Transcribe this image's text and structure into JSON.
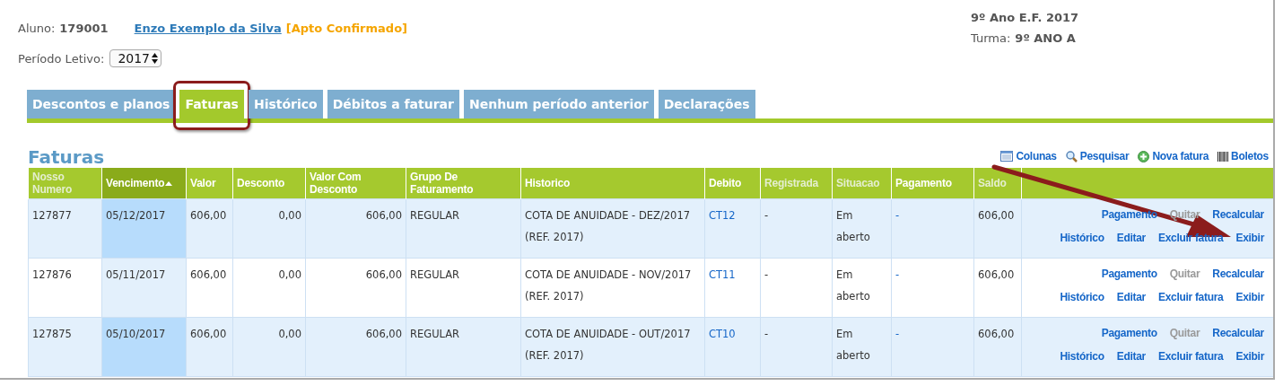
{
  "student": {
    "label": "Aluno:",
    "id": "179001",
    "name": "Enzo Exemplo da Silva",
    "status": "[Apto Confirmado]"
  },
  "class_info": {
    "grade": "9º Ano E.F. 2017",
    "turma_label": "Turma:",
    "turma": "9º ANO A"
  },
  "period": {
    "label": "Período Letivo:",
    "value": "2017"
  },
  "tabs": [
    {
      "label": "Descontos e planos",
      "selected": false,
      "highlighted": false
    },
    {
      "label": "Faturas",
      "selected": true,
      "highlighted": true
    },
    {
      "label": "Histórico",
      "selected": false,
      "highlighted": false
    },
    {
      "label": "Débitos a faturar",
      "selected": false,
      "highlighted": false
    },
    {
      "label": "Nenhum período anterior",
      "selected": false,
      "highlighted": false
    },
    {
      "label": "Declarações",
      "selected": false,
      "highlighted": false
    }
  ],
  "section_title": "Faturas",
  "toolbar": [
    {
      "kind": "columns",
      "label": "Colunas"
    },
    {
      "kind": "search",
      "label": "Pesquisar"
    },
    {
      "kind": "add",
      "label": "Nova fatura"
    },
    {
      "kind": "barcode",
      "label": "Boletos"
    }
  ],
  "table": {
    "columns": [
      {
        "label": "Nosso Numero",
        "dimmed": true,
        "sorted": false,
        "link": false
      },
      {
        "label": "Vencimento",
        "dimmed": false,
        "sorted": true,
        "link": false
      },
      {
        "label": "Valor",
        "dimmed": false,
        "sorted": false,
        "link": false
      },
      {
        "label": "Desconto",
        "dimmed": false,
        "sorted": false,
        "link": false
      },
      {
        "label": "Valor Com Desconto",
        "dimmed": false,
        "sorted": false,
        "link": false
      },
      {
        "label": "Grupo De Faturamento",
        "dimmed": false,
        "sorted": false,
        "link": false
      },
      {
        "label": "Historico",
        "dimmed": false,
        "sorted": false,
        "link": false
      },
      {
        "label": "Debito",
        "dimmed": false,
        "sorted": false,
        "link": true
      },
      {
        "label": "Registrada",
        "dimmed": true,
        "sorted": false,
        "link": false
      },
      {
        "label": "Situacao",
        "dimmed": true,
        "sorted": false,
        "link": false
      },
      {
        "label": "Pagamento",
        "dimmed": false,
        "sorted": false,
        "link": true
      },
      {
        "label": "Saldo",
        "dimmed": true,
        "sorted": false,
        "link": false
      }
    ],
    "rows": [
      {
        "cells": [
          "127877",
          "05/12/2017",
          "606,00",
          "0,00",
          "606,00",
          "REGULAR",
          "COTA DE ANUIDADE - DEZ/2017 (REF. 2017)",
          "CT12",
          "-",
          "Em aberto",
          "-",
          "606,00"
        ],
        "actions": [
          [
            {
              "label": "Pagamento",
              "disabled": false
            },
            {
              "label": "Quitar",
              "disabled": true
            },
            {
              "label": "Recalcular",
              "disabled": false
            }
          ],
          [
            {
              "label": "Histórico",
              "disabled": false
            },
            {
              "label": "Editar",
              "disabled": false
            },
            {
              "label": "Excluir fatura",
              "disabled": false
            },
            {
              "label": "Exibir",
              "disabled": false
            }
          ]
        ]
      },
      {
        "cells": [
          "127876",
          "05/11/2017",
          "606,00",
          "0,00",
          "606,00",
          "REGULAR",
          "COTA DE ANUIDADE - NOV/2017 (REF. 2017)",
          "CT11",
          "-",
          "Em aberto",
          "-",
          "606,00"
        ],
        "actions": [
          [
            {
              "label": "Pagamento",
              "disabled": false
            },
            {
              "label": "Quitar",
              "disabled": true
            },
            {
              "label": "Recalcular",
              "disabled": false
            }
          ],
          [
            {
              "label": "Histórico",
              "disabled": false
            },
            {
              "label": "Editar",
              "disabled": false
            },
            {
              "label": "Excluir fatura",
              "disabled": false
            },
            {
              "label": "Exibir",
              "disabled": false
            }
          ]
        ]
      },
      {
        "cells": [
          "127875",
          "05/10/2017",
          "606,00",
          "0,00",
          "606,00",
          "REGULAR",
          "COTA DE ANUIDADE - OUT/2017 (REF. 2017)",
          "CT10",
          "-",
          "Em aberto",
          "-",
          "606,00"
        ],
        "actions": [
          [
            {
              "label": "Pagamento",
              "disabled": false
            },
            {
              "label": "Quitar",
              "disabled": true
            },
            {
              "label": "Recalcular",
              "disabled": false
            }
          ],
          [
            {
              "label": "Histórico",
              "disabled": false
            },
            {
              "label": "Editar",
              "disabled": false
            },
            {
              "label": "Excluir fatura",
              "disabled": false
            },
            {
              "label": "Exibir",
              "disabled": false
            }
          ]
        ]
      }
    ]
  }
}
